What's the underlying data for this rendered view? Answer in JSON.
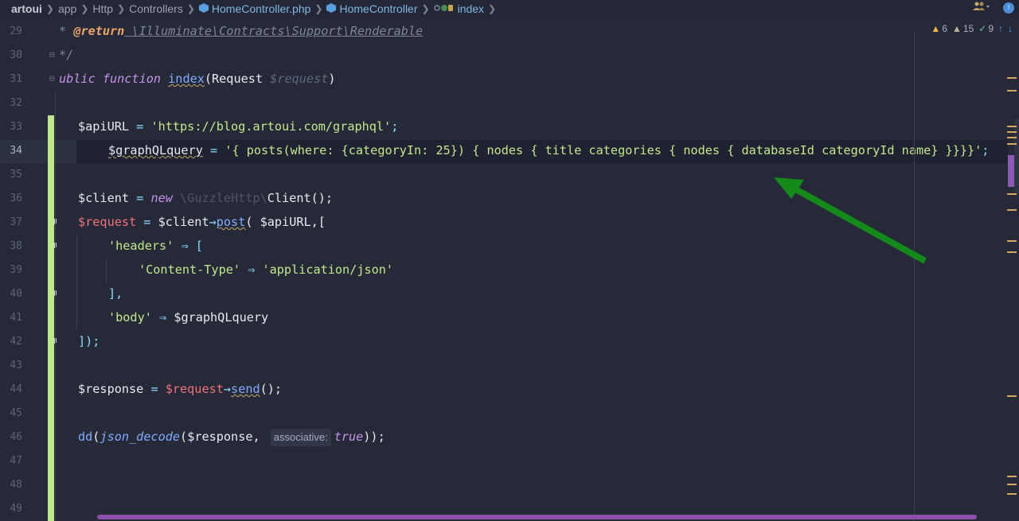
{
  "breadcrumb": {
    "items": [
      {
        "label": "artoui"
      },
      {
        "label": "app"
      },
      {
        "label": "Http"
      },
      {
        "label": "Controllers"
      },
      {
        "label": "HomeController.php"
      },
      {
        "label": "HomeController"
      },
      {
        "label": "index"
      }
    ]
  },
  "inspections": {
    "warnings": "6",
    "weak_warnings": "15",
    "typos": "9"
  },
  "line_numbers": [
    "29",
    "30",
    "31",
    "32",
    "33",
    "34",
    "35",
    "36",
    "37",
    "38",
    "39",
    "40",
    "41",
    "42",
    "43",
    "44",
    "45",
    "46",
    "47",
    "48",
    "49"
  ],
  "code": {
    "l29_star": "* ",
    "l29_tag": "@return",
    "l29_type": " \\Illuminate\\Contracts\\Support\\Renderable",
    "l30": "*/",
    "l31_kw": "ublic function ",
    "l31_fn": "index",
    "l31_p1": "(Request ",
    "l31_p2": "$request",
    "l31_p3": ")",
    "l33_var": "$apiURL",
    "l33_eq": " = ",
    "l33_str": "'https://blog.artoui.com/graphql'",
    "l33_end": ";",
    "l34_var": "$graphQLquery",
    "l34_eq": " = ",
    "l34_str": "'{ posts(where: {categoryIn: 25}) { nodes { title categories { nodes { databaseId categoryId name} }}}}'",
    "l34_end": ";",
    "l36_var": "$client",
    "l36_eq": " = ",
    "l36_new": "new",
    "l36_ns": " \\GuzzleHttp\\",
    "l36_cls": "Client",
    "l36_end": "();",
    "l37_var": "$request",
    "l37_eq": " = ",
    "l37_client": "$client",
    "l37_arrow": "→",
    "l37_fn": "post",
    "l37_args": "( $apiURL,[",
    "l38_key": "'headers'",
    "l38_arr": " ⇒ [",
    "l39_key": "'Content-Type'",
    "l39_arr": " ⇒ ",
    "l39_val": "'application/json'",
    "l40": "],",
    "l41_key": "'body'",
    "l41_arr": " ⇒ ",
    "l41_val": "$graphQLquery",
    "l42": "]);",
    "l44_var": "$response",
    "l44_eq": " = ",
    "l44_req": "$request",
    "l44_arrow": "→",
    "l44_fn": "send",
    "l44_end": "();",
    "l46_dd": "dd",
    "l46_open": "(",
    "l46_fn": "json_decode",
    "l46_arg": "($response, ",
    "l46_hint": "associative:",
    "l46_true": "true",
    "l46_end": "));"
  },
  "colors": {
    "background": "#262a38",
    "arrow": "#138a19",
    "vcs_added": "#c1e78c"
  }
}
